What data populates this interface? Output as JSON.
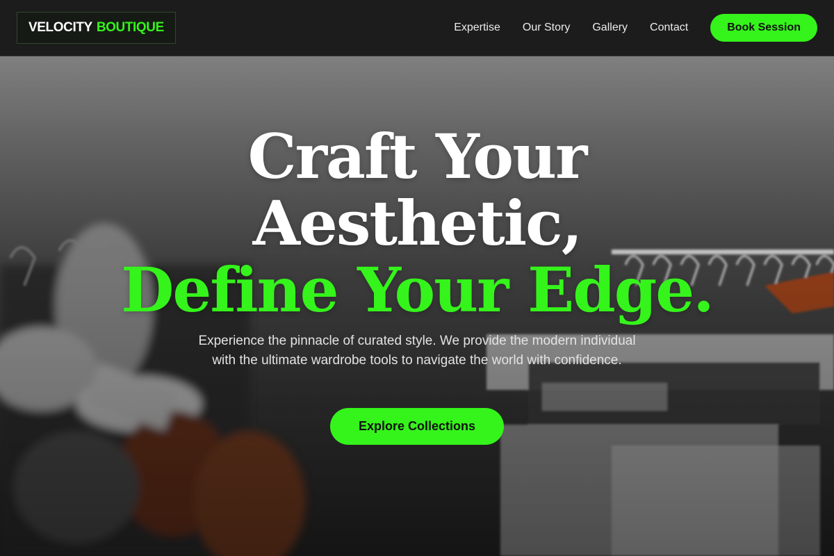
{
  "brand": {
    "word1": "VELOCITY",
    "word2": "BOUTIQUE",
    "accent_color": "#35f41b"
  },
  "nav": {
    "items": [
      {
        "label": "Expertise"
      },
      {
        "label": "Our Story"
      },
      {
        "label": "Gallery"
      },
      {
        "label": "Contact"
      }
    ],
    "cta_label": "Book Session"
  },
  "hero": {
    "background": "photo of clothing rack with white hangers and garments",
    "headline_line1": "Craft Your",
    "headline_line2": "Aesthetic,",
    "headline_line3": "Define Your Edge.",
    "subtext": "Experience the pinnacle of curated style. We provide the modern individual with the ultimate wardrobe tools to navigate the world with confidence.",
    "cta_label": "Explore Collections"
  }
}
